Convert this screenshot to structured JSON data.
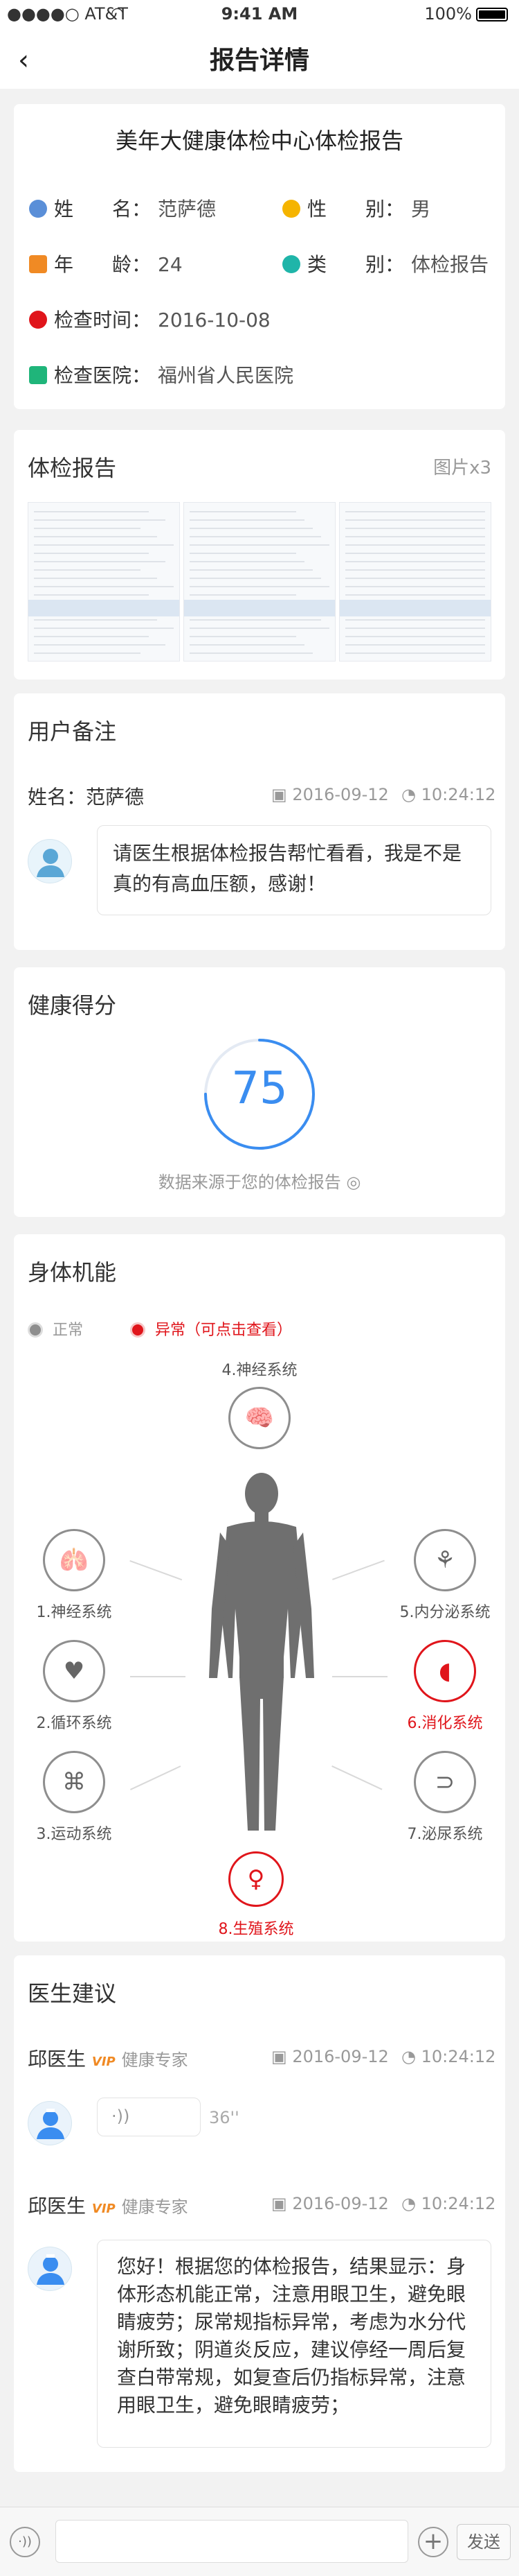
{
  "status_bar": {
    "carrier": "●●●●○ AT&T",
    "wifi_icon": "wifi-icon",
    "time": "9:41 AM",
    "battery": "100%"
  },
  "nav": {
    "title": "报告详情",
    "back_icon": "chevron-left-icon"
  },
  "report_info": {
    "title": "美年大健康体检中心体检报告",
    "name_label": "姓　　名：",
    "name_value": "范萨德",
    "gender_label": "性　　别：",
    "gender_value": "男",
    "age_label": "年　　龄：",
    "age_value": "24",
    "type_label": "类　　别：",
    "type_value": "体检报告",
    "time_label": "检查时间：",
    "time_value": "2016-10-08",
    "hospital_label": "检查医院：",
    "hospital_value": "福州省人民医院",
    "colors": {
      "name": "#5a8fd8",
      "gender": "#f5b400",
      "age": "#f08a24",
      "type": "#1fb5a9",
      "time": "#e0151b",
      "hospital": "#1fb57a"
    }
  },
  "exam_report": {
    "title": "体检报告",
    "count": "图片x3"
  },
  "user_note": {
    "title": "用户备注",
    "name_label": "姓名：",
    "name_value": "范萨德",
    "date": "2016-09-12",
    "time": "10:24:12",
    "message": "请医生根据体检报告帮忙看看，我是不是真的有高血压额，感谢！"
  },
  "health_score": {
    "title": "健康得分",
    "score": "75",
    "score_fraction": 0.75,
    "source": "数据来源于您的体检报告"
  },
  "body_function": {
    "title": "身体机能",
    "legend_normal": "正常",
    "legend_abnormal": "异常（可点击查看）",
    "systems": [
      {
        "label": "4.神经系统",
        "icon": "brain-icon",
        "status": "normal"
      },
      {
        "label": "1.神经系统",
        "icon": "lungs-icon",
        "status": "normal"
      },
      {
        "label": "5.内分泌系统",
        "icon": "pancreas-icon",
        "status": "normal"
      },
      {
        "label": "2.循环系统",
        "icon": "heart-icon",
        "status": "normal"
      },
      {
        "label": "6.消化系统",
        "icon": "stomach-icon",
        "status": "abnormal"
      },
      {
        "label": "3.运动系统",
        "icon": "bone-icon",
        "status": "normal"
      },
      {
        "label": "7.泌尿系统",
        "icon": "kidney-icon",
        "status": "normal"
      },
      {
        "label": "8.生殖系统",
        "icon": "reproductive-icon",
        "status": "abnormal"
      }
    ],
    "colors": {
      "normal": "#8e8e8e",
      "abnormal": "#e0151b"
    }
  },
  "doctor_advice": {
    "title": "医生建议",
    "entries": [
      {
        "doctor": "邱医生",
        "vip": "VIP",
        "role": "健康专家",
        "date": "2016-09-12",
        "time": "10:24:12",
        "voice_duration": "36''"
      },
      {
        "doctor": "邱医生",
        "vip": "VIP",
        "role": "健康专家",
        "date": "2016-09-12",
        "time": "10:24:12",
        "message": "您好！根据您的体检报告，结果显示：身体形态机能正常，注意用眼卫生，避免眼睛疲劳；尿常规指标异常，考虑为水分代谢所致；阴道炎反应，建议停经一周后复查白带常规，如复查后仍指标异常，注意用眼卫生，避免眼睛疲劳；"
      }
    ]
  },
  "input_bar": {
    "placeholder": "",
    "send_label": "发送"
  }
}
